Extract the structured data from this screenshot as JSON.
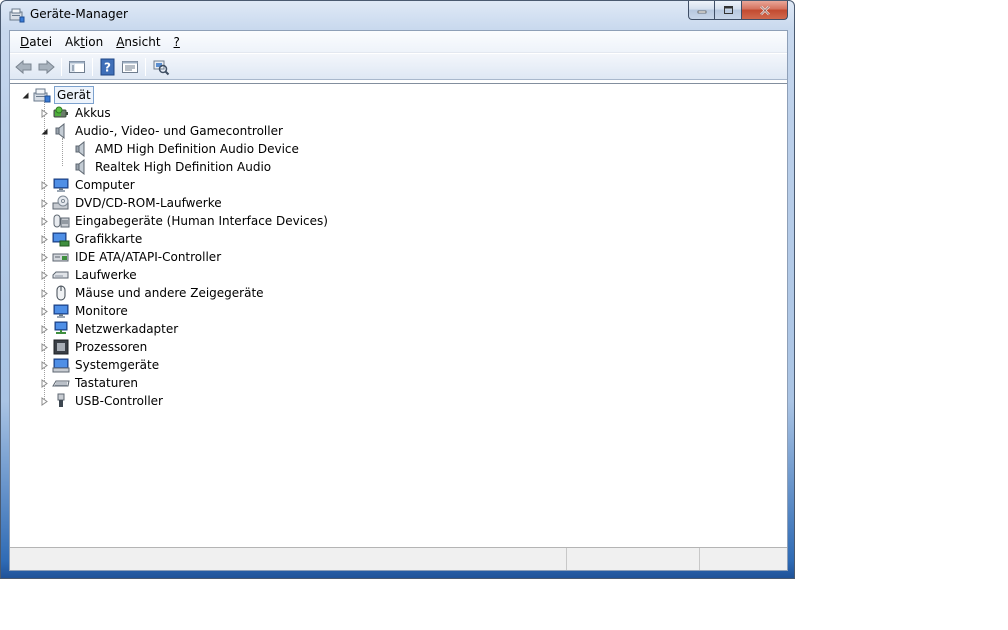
{
  "window": {
    "title": "Geräte-Manager"
  },
  "menu": [
    {
      "key": "D",
      "rest": "atei"
    },
    {
      "pre": "Ak",
      "key": "t",
      "rest": "ion"
    },
    {
      "key": "A",
      "rest": "nsicht"
    },
    {
      "key": "?",
      "rest": ""
    }
  ],
  "toolbar": {
    "buttons": [
      "back-arrow-icon",
      "forward-arrow-icon",
      "show-hide-console-tree-icon",
      "help-icon",
      "properties-icon",
      "scan-hardware-icon"
    ]
  },
  "tree": {
    "root": {
      "label": "Gerät",
      "icon": "computer-icon",
      "expanded": true
    },
    "categories": [
      {
        "label": "Akkus",
        "icon": "battery-icon",
        "expanded": false
      },
      {
        "label": "Audio-, Video- und Gamecontroller",
        "icon": "speaker-icon",
        "expanded": true,
        "children": [
          {
            "label": "AMD High Definition Audio Device",
            "icon": "speaker-icon"
          },
          {
            "label": "Realtek High Definition Audio",
            "icon": "speaker-icon"
          }
        ]
      },
      {
        "label": "Computer",
        "icon": "computer-icon",
        "expanded": false
      },
      {
        "label": "DVD/CD-ROM-Laufwerke",
        "icon": "optical-drive-icon",
        "expanded": false
      },
      {
        "label": "Eingabegeräte (Human Interface Devices)",
        "icon": "hid-icon",
        "expanded": false
      },
      {
        "label": "Grafikkarte",
        "icon": "display-adapter-icon",
        "expanded": false
      },
      {
        "label": "IDE ATA/ATAPI-Controller",
        "icon": "ide-controller-icon",
        "expanded": false
      },
      {
        "label": "Laufwerke",
        "icon": "disk-drive-icon",
        "expanded": false
      },
      {
        "label": "Mäuse und andere Zeigegeräte",
        "icon": "mouse-icon",
        "expanded": false
      },
      {
        "label": "Monitore",
        "icon": "monitor-icon",
        "expanded": false
      },
      {
        "label": "Netzwerkadapter",
        "icon": "network-adapter-icon",
        "expanded": false
      },
      {
        "label": "Prozessoren",
        "icon": "processor-icon",
        "expanded": false
      },
      {
        "label": "Systemgeräte",
        "icon": "system-devices-icon",
        "expanded": false
      },
      {
        "label": "Tastaturen",
        "icon": "keyboard-icon",
        "expanded": false
      },
      {
        "label": "USB-Controller",
        "icon": "usb-icon",
        "expanded": false
      }
    ]
  },
  "colors": {
    "accent": "#2f6bb5",
    "close_button": "#c24a30",
    "selection_border": "#7da2ce"
  }
}
